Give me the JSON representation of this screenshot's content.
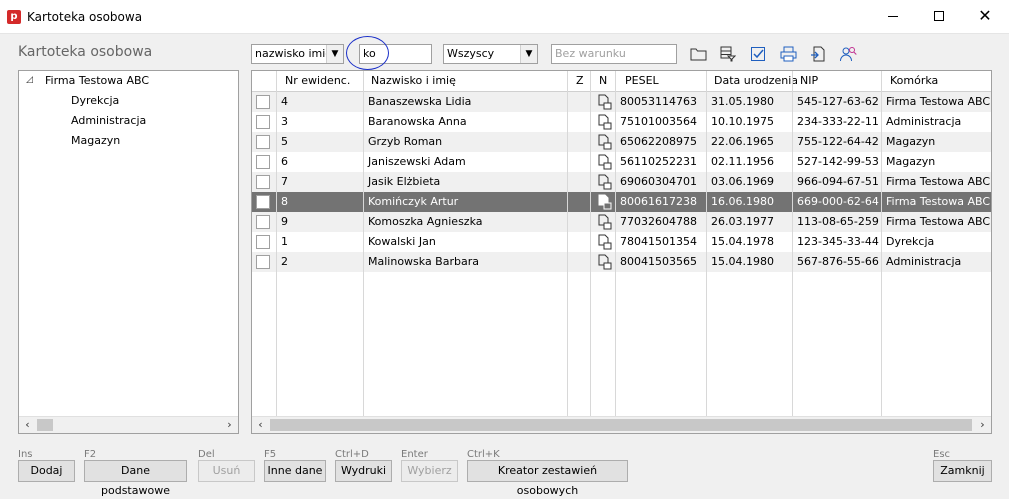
{
  "window": {
    "title": "Kartoteka osobowa",
    "app_icon": "p"
  },
  "left_panel": {
    "title": "Kartoteka osobowa",
    "tree": [
      {
        "label": "Firma Testowa ABC",
        "expanded": true
      },
      {
        "label": "Dyrekcja"
      },
      {
        "label": "Administracja"
      },
      {
        "label": "Magazyn"
      }
    ]
  },
  "toolbar": {
    "search_field_select": "nazwisko imię",
    "search_value": "ko",
    "filter_select": "Wszyscy",
    "condition_placeholder": "Bez warunku"
  },
  "grid": {
    "columns": [
      "Nr ewidenc.",
      "Nazwisko i imię",
      "Z",
      "N",
      "PESEL",
      "Data urodzenia",
      "NIP",
      "Komórka"
    ],
    "rows": [
      {
        "nr": "4",
        "name": "Banaszewska Lidia",
        "pesel": "80053114763",
        "dob": "31.05.1980",
        "nip": "545-127-63-62",
        "unit": "Firma Testowa ABC"
      },
      {
        "nr": "3",
        "name": "Baranowska Anna",
        "pesel": "75101003564",
        "dob": "10.10.1975",
        "nip": "234-333-22-11",
        "unit": "Administracja"
      },
      {
        "nr": "5",
        "name": "Grzyb Roman",
        "pesel": "65062208975",
        "dob": "22.06.1965",
        "nip": "755-122-64-42",
        "unit": "Magazyn"
      },
      {
        "nr": "6",
        "name": "Janiszewski Adam",
        "pesel": "56110252231",
        "dob": "02.11.1956",
        "nip": "527-142-99-53",
        "unit": "Magazyn"
      },
      {
        "nr": "7",
        "name": "Jasik Elżbieta",
        "pesel": "69060304701",
        "dob": "03.06.1969",
        "nip": "966-094-67-51",
        "unit": "Firma Testowa ABC"
      },
      {
        "nr": "8",
        "name": "Komińczyk Artur",
        "pesel": "80061617238",
        "dob": "16.06.1980",
        "nip": "669-000-62-64",
        "unit": "Firma Testowa ABC"
      },
      {
        "nr": "9",
        "name": "Komoszka Agnieszka",
        "pesel": "77032604788",
        "dob": "26.03.1977",
        "nip": "113-08-65-259",
        "unit": "Firma Testowa ABC"
      },
      {
        "nr": "1",
        "name": "Kowalski Jan",
        "pesel": "78041501354",
        "dob": "15.04.1978",
        "nip": "123-345-33-44",
        "unit": "Dyrekcja"
      },
      {
        "nr": "2",
        "name": "Malinowska Barbara",
        "pesel": "80041503565",
        "dob": "15.04.1980",
        "nip": "567-876-55-66",
        "unit": "Administracja"
      }
    ],
    "selected_row": 5
  },
  "buttons": [
    {
      "shortcut": "Ins",
      "label": "Dodaj",
      "enabled": true
    },
    {
      "shortcut": "F2",
      "label": "Dane podstawowe",
      "enabled": true
    },
    {
      "shortcut": "Del",
      "label": "Usuń",
      "enabled": false
    },
    {
      "shortcut": "F5",
      "label": "Inne dane",
      "enabled": true
    },
    {
      "shortcut": "Ctrl+D",
      "label": "Wydruki",
      "enabled": true
    },
    {
      "shortcut": "Enter",
      "label": "Wybierz",
      "enabled": false
    },
    {
      "shortcut": "Ctrl+K",
      "label": "Kreator zestawień osobowych",
      "enabled": true
    },
    {
      "shortcut": "Esc",
      "label": "Zamknij",
      "enabled": true
    }
  ],
  "colors": {
    "accent": "#1a2fc8",
    "app_icon": "#d42a2a",
    "selected_row": "#737373",
    "icon_blue": "#1f5fbf"
  }
}
